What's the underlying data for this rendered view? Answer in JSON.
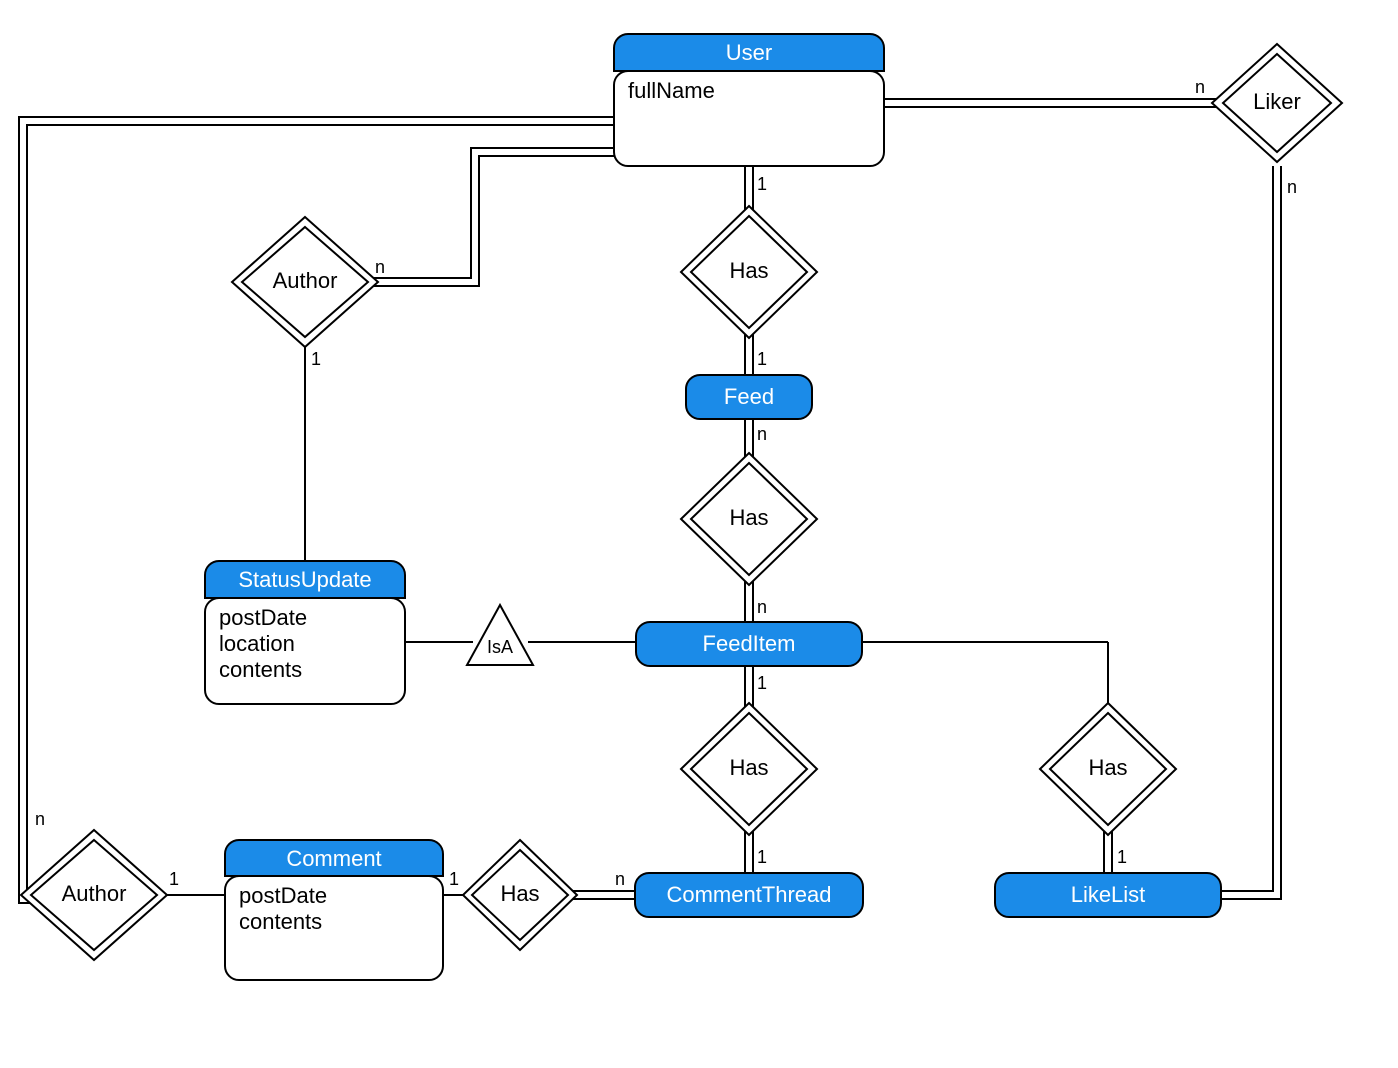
{
  "entities": {
    "user": {
      "title": "User",
      "attrs": [
        "fullName"
      ]
    },
    "statusUpdate": {
      "title": "StatusUpdate",
      "attrs": [
        "postDate",
        "location",
        "contents"
      ]
    },
    "comment": {
      "title": "Comment",
      "attrs": [
        "postDate",
        "contents"
      ]
    },
    "feed": {
      "title": "Feed"
    },
    "feedItem": {
      "title": "FeedItem"
    },
    "commentThread": {
      "title": "CommentThread"
    },
    "likeList": {
      "title": "LikeList"
    }
  },
  "relationships": {
    "authorTop": "Author",
    "authorBottom": "Author",
    "liker": "Liker",
    "hasUserFeed": "Has",
    "hasFeedItem": "Has",
    "hasCommentThread": "Has",
    "hasLikeList": "Has",
    "hasComment": "Has",
    "isA": "IsA"
  },
  "cardinalities": {
    "one": "1",
    "many": "n"
  }
}
